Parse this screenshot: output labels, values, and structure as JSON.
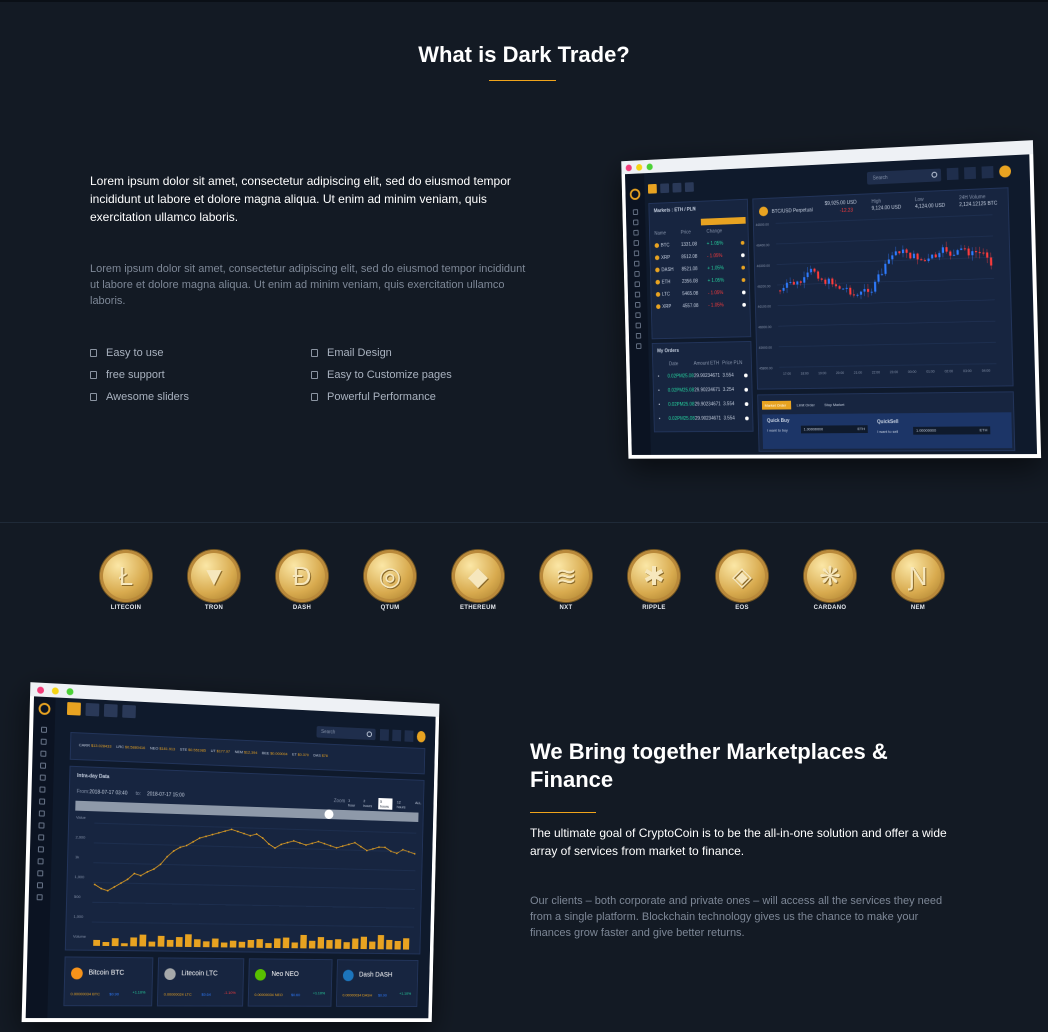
{
  "section1": {
    "title": "What is Dark Trade?",
    "lead": "Lorem ipsum dolor sit amet, consectetur adipiscing elit, sed do eiusmod tempor incididunt ut labore et dolore magna aliqua. Ut enim ad minim veniam, quis exercitation ullamco laboris.",
    "body": "Lorem ipsum dolor sit amet, consectetur adipiscing elit, sed do eiusmod tempor incididunt ut labore et dolore magna aliqua. Ut enim ad minim veniam, quis exercitation ullamco laboris.",
    "features": [
      "Easy to use",
      "Email Design",
      "free support",
      "Easy to Customize pages",
      "Awesome sliders",
      "Powerful Performance"
    ]
  },
  "mockup1": {
    "search": "Search",
    "markets_title": "Markets : ETH / PLN",
    "market_tabs": [
      "EUR",
      "USD",
      "BTC",
      "ETH"
    ],
    "market_cols": [
      "Name",
      "Price",
      "Change"
    ],
    "markets": [
      {
        "name": "BTC",
        "price": "1331.08",
        "change": "+ 1.05%"
      },
      {
        "name": "XRP",
        "price": "8512.08",
        "change": "- 1.05%"
      },
      {
        "name": "DASH",
        "price": "8521.08",
        "change": "+ 1.05%"
      },
      {
        "name": "ETH",
        "price": "2356.08",
        "change": "+ 1.05%"
      },
      {
        "name": "LTC",
        "price": "5465.08",
        "change": "- 1.05%"
      },
      {
        "name": "XRP",
        "price": "4557.08",
        "change": "- 1.05%"
      }
    ],
    "orders_title": "My Orders",
    "order_cols": [
      "Date",
      "Amount ETH",
      "Price PLN"
    ],
    "orders": [
      {
        "date": "0.02PM25.08",
        "amount": "29.90234671",
        "price": "3.554"
      },
      {
        "date": "0.02PM25.08",
        "amount": "29.90234671",
        "price": "3.254"
      },
      {
        "date": "0.02PM25.08",
        "amount": "29.90234671",
        "price": "3.554"
      },
      {
        "date": "0.02PM25.08",
        "amount": "29.90234671",
        "price": "3.554"
      }
    ],
    "pair_label": "BTC/USD Perpetual",
    "pair_price": "$9,925.00 USD",
    "pair_change": "-12.23",
    "high_label": "High",
    "high_value": "9,124.00 USD",
    "low_label": "Low",
    "low_value": "4,124.00 USD",
    "vol_label": "24H Volume",
    "vol_value": "2,124.12125 BTC",
    "y_ticks": [
      "46500.00",
      "46400.00",
      "46300.00",
      "46200.00",
      "46100.00",
      "46000.00",
      "45900.00",
      "45800.00"
    ],
    "x_ticks": [
      "17:00",
      "18:00",
      "19:00",
      "20:00",
      "21:00",
      "22:00",
      "23:00",
      "00:00",
      "01:00",
      "02:00",
      "03:00",
      "04:00"
    ],
    "order_tabs": [
      "Market Order",
      "Limit Order",
      "Stop Market"
    ],
    "quick_buy": "Quick Buy",
    "quick_sell": "QuickSell",
    "buy_input_label": "I want to buy",
    "sell_input_label": "I want to sell",
    "buy_value": "1.00000000",
    "sell_value": "1.00000000",
    "unit": "ETH"
  },
  "coins": [
    "LITECOIN",
    "TRON",
    "DASH",
    "QTUM",
    "ETHEREUM",
    "NXT",
    "RIPPLE",
    "EOS",
    "CARDANO",
    "NEM"
  ],
  "coin_icons": [
    "litecoin-icon",
    "tron-icon",
    "dash-icon",
    "qtum-icon",
    "ethereum-icon",
    "nxt-icon",
    "ripple-icon",
    "eos-icon",
    "cardano-icon",
    "nem-icon"
  ],
  "mockup2": {
    "search": "Search",
    "ticker": [
      {
        "name": "CARR",
        "value": "$13.028433"
      },
      {
        "name": "LRC",
        "value": "$0.5880416"
      },
      {
        "name": "NEO",
        "value": "$181.913"
      },
      {
        "name": "STE",
        "value": "$0.551985"
      },
      {
        "name": "UT",
        "value": "$177.97"
      },
      {
        "name": "NEM",
        "value": "$12,394"
      },
      {
        "name": "BEE",
        "value": "$0.000004"
      },
      {
        "name": "ET",
        "value": "$0.370"
      },
      {
        "name": "DAS",
        "value": "$78"
      }
    ],
    "chart_title": "Intra-day Data",
    "from_label": "From:",
    "from_value": "2018-07-17 03:40",
    "to_label": "to:",
    "to_value": "2018-07-17 15:00",
    "zoom_label": "Zoom",
    "zoom_options": [
      "1 hour",
      "2 hours",
      "5 hours",
      "12 hours",
      "ALL"
    ],
    "y_ticks": [
      "Value",
      "2,000",
      "1k",
      "1,000",
      "500",
      "1,000",
      "Volume"
    ],
    "cards": [
      {
        "name": "Bitcoin BTC",
        "amount": "0.00000034 BTC",
        "sub": "$0.90",
        "change": "+1.10%",
        "color": "#f7931a"
      },
      {
        "name": "Litecoin LTC",
        "amount": "0.00000024 LTC",
        "sub": "$0.64",
        "change": "-1.10%",
        "color": "#a6a9aa"
      },
      {
        "name": "Neo NEO",
        "amount": "0.00000034 NEO",
        "sub": "$0.60",
        "change": "+1.10%",
        "color": "#58bf00"
      },
      {
        "name": "Dash DASH",
        "amount": "0.00000034 DASH",
        "sub": "$0.90",
        "change": "+1.10%",
        "color": "#1c75bc"
      }
    ]
  },
  "section2": {
    "title": "We Bring together Marketplaces & Finance",
    "lead": "The ultimate goal of CryptoCoin is to be the all-in-one solution and offer a wide array of services from market to finance.",
    "body": "Our clients – both corporate and private ones – will access all the services they need from a single platform. Blockchain technology gives us the chance to make your finances grow faster and give better returns."
  },
  "colors": {
    "accent": "#f0a41b",
    "background": "#131a24",
    "up": "#26d6a0",
    "down": "#ff3b3b"
  }
}
